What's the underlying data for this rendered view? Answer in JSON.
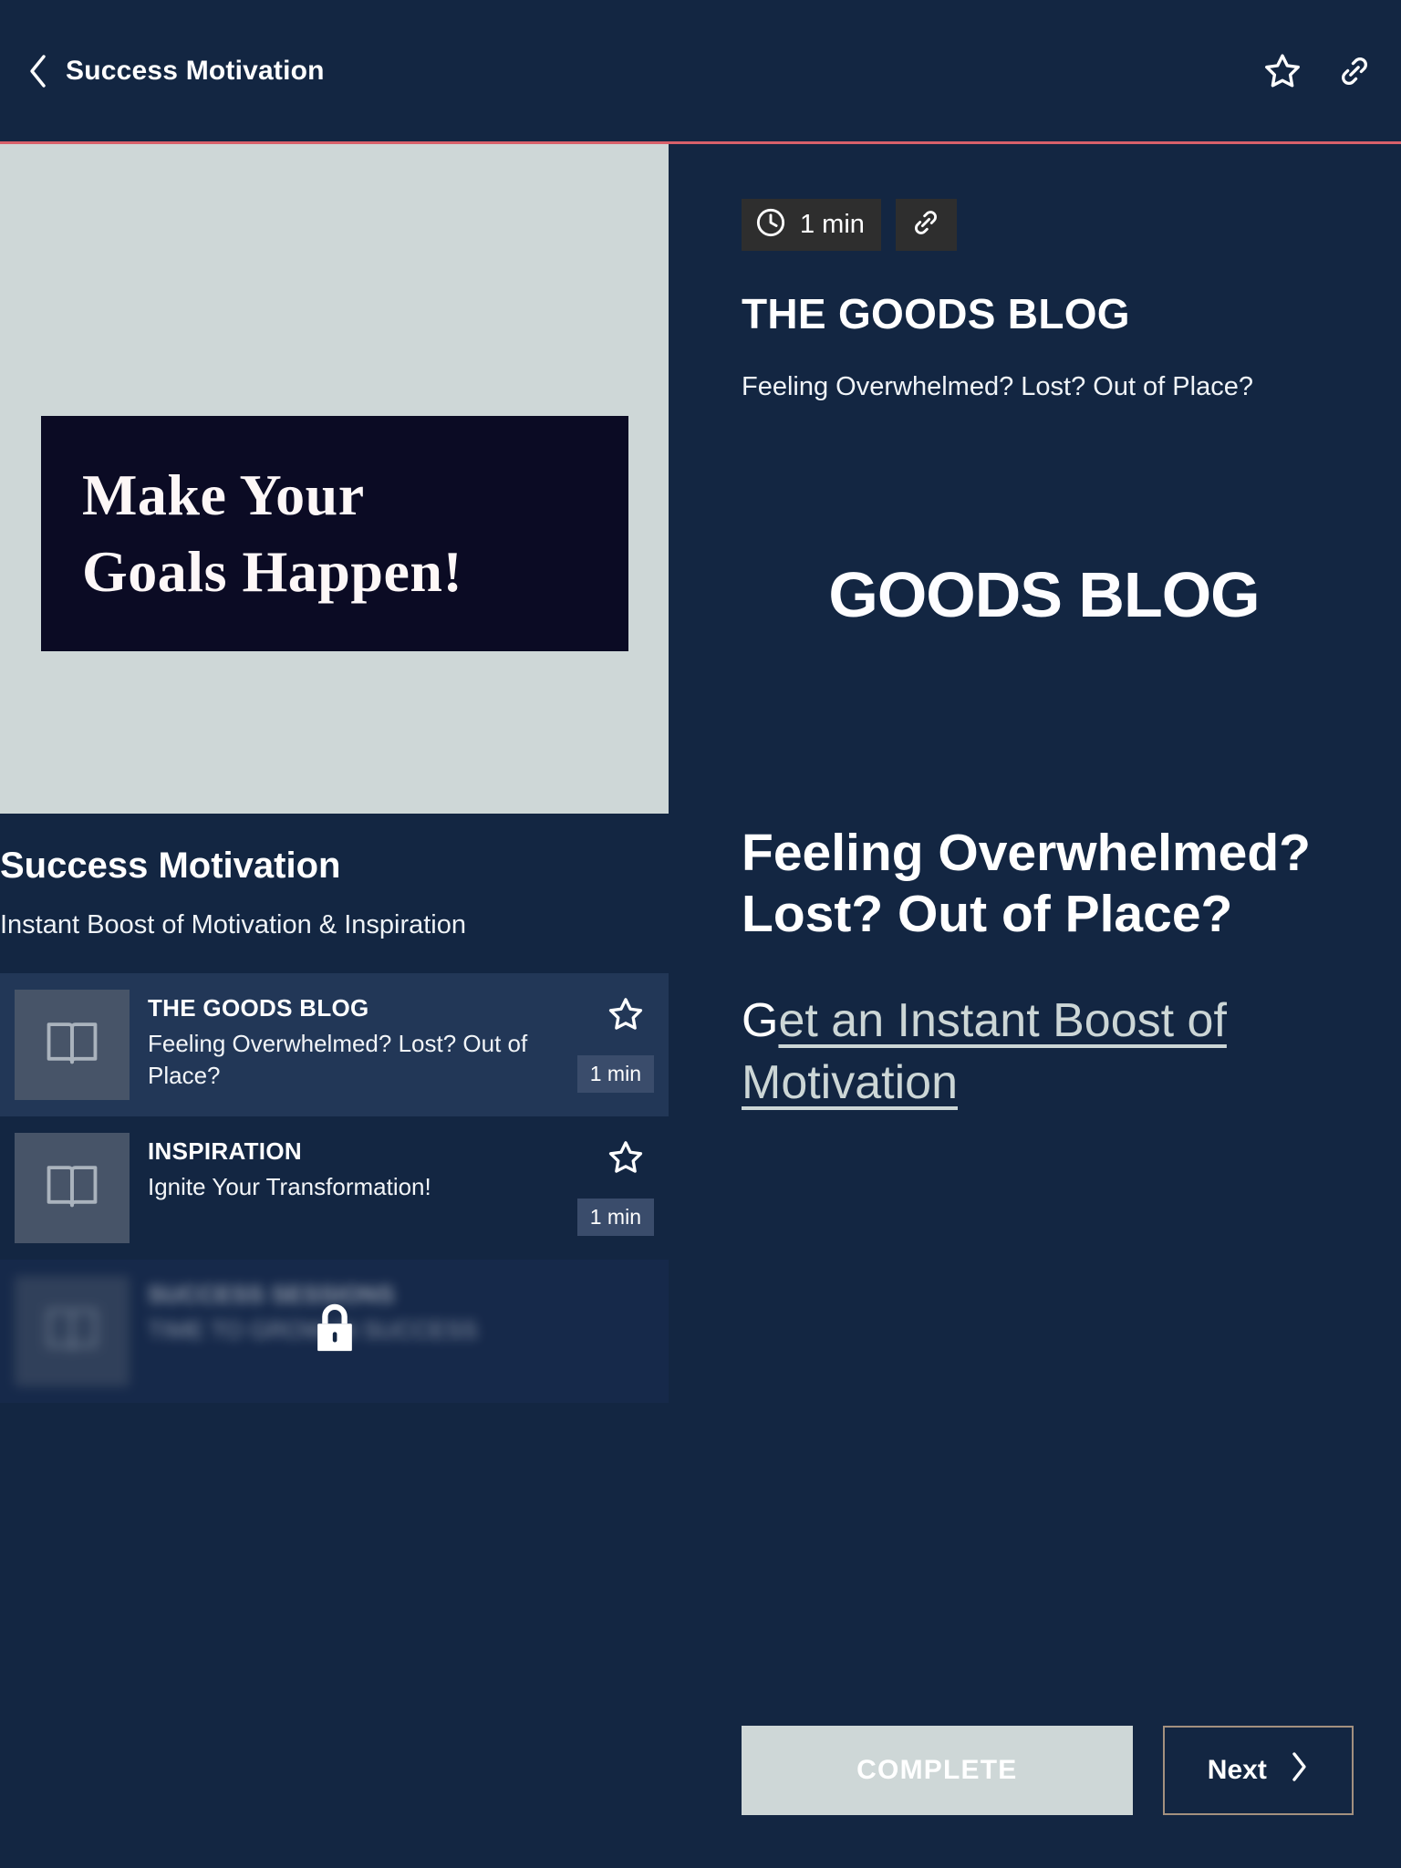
{
  "colors": {
    "background": "#132642",
    "accent_rule": "#d8606a",
    "light_panel": "#ced7d7",
    "banner_dark": "#0b0b24",
    "thumb": "#475468",
    "badge_dark": "#2e2e2e",
    "next_border": "#a3907f",
    "link": "#ccd6d6"
  },
  "header": {
    "back_icon": "chevron-left-icon",
    "title": "Success Motivation",
    "star_icon": "star-outline-icon",
    "link_icon": "link-chain-icon"
  },
  "hero": {
    "banner_line1": "Make Your",
    "banner_line2": "Goals Happen!"
  },
  "course": {
    "title": "Success Motivation",
    "subtitle": "Instant Boost of Motivation & Inspiration",
    "lessons": [
      {
        "kicker": "THE GOODS BLOG",
        "description": "Feeling Overwhelmed? Lost? Out of Place?",
        "duration": "1 min",
        "thumb_icon": "open-book-icon",
        "star_icon": "star-outline-icon",
        "locked": false,
        "active": true
      },
      {
        "kicker": "INSPIRATION",
        "description": "Ignite Your Transformation!",
        "duration": "1 min",
        "thumb_icon": "open-book-icon",
        "star_icon": "star-outline-icon",
        "locked": false,
        "active": false
      },
      {
        "kicker": "SUCCESS SESSIONS",
        "description": "TIME TO GROW IN SUCCESS",
        "duration": "",
        "thumb_icon": "open-book-icon",
        "star_icon": "",
        "locked": true,
        "lock_icon": "lock-icon",
        "active": false
      }
    ]
  },
  "article": {
    "clock_icon": "clock-icon",
    "duration": "1 min",
    "link_icon": "link-chain-icon",
    "title": "THE GOODS BLOG",
    "subtitle": "Feeling Overwhelmed? Lost? Out of Place?",
    "brand_logo": "GOODS BLOG",
    "headline": "Feeling Overwhelmed? Lost? Out of Place?",
    "cta_lead": "G",
    "cta_link": "et an Instant Boost of Motivation  "
  },
  "footer": {
    "complete_label": "COMPLETE",
    "next_label": "Next",
    "next_icon": "chevron-right-icon"
  }
}
